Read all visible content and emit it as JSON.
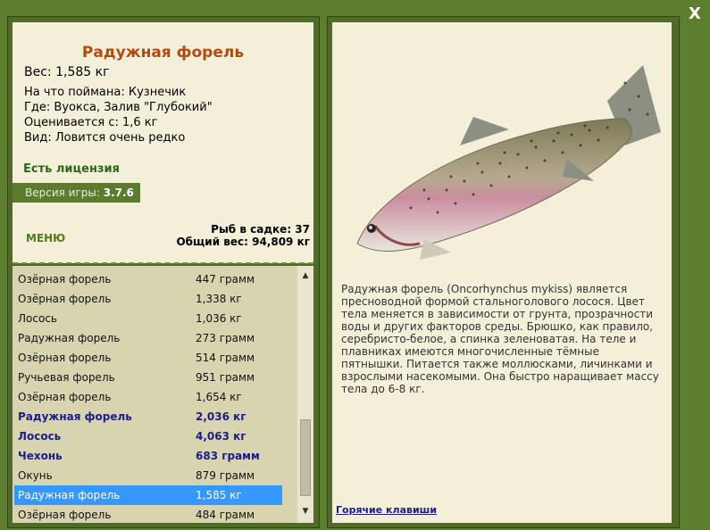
{
  "close_label": "X",
  "fish": {
    "title": "Радужная форель",
    "weight": "Вес: 1,585 кг",
    "caught_with": "На что поймана: Кузнечик",
    "where": "Где: Вуокса, Залив \"Глубокий\"",
    "rated_from": "Оценивается с: 1,6 кг",
    "rarity": "Вид: Ловится очень редко"
  },
  "license": "Есть лицензия",
  "version": {
    "label": "Версия игры:",
    "value": "3.7.6"
  },
  "menu_label": "МЕНЮ",
  "stats": {
    "fish_in_net": "Рыб в садке: 37",
    "total_weight": "Общий вес: 94,809 кг"
  },
  "fish_list": [
    {
      "name": "Озёрная форель",
      "weight": "447 грамм",
      "bold": false,
      "selected": false
    },
    {
      "name": "Озёрная форель",
      "weight": "1,338 кг",
      "bold": false,
      "selected": false
    },
    {
      "name": "Лосось",
      "weight": "1,036 кг",
      "bold": false,
      "selected": false
    },
    {
      "name": "Радужная форель",
      "weight": "273 грамм",
      "bold": false,
      "selected": false
    },
    {
      "name": "Озёрная форель",
      "weight": "514 грамм",
      "bold": false,
      "selected": false
    },
    {
      "name": "Ручьевая форель",
      "weight": "951 грамм",
      "bold": false,
      "selected": false
    },
    {
      "name": "Озёрная форель",
      "weight": "1,654 кг",
      "bold": false,
      "selected": false
    },
    {
      "name": "Радужная форель",
      "weight": "2,036 кг",
      "bold": true,
      "selected": false
    },
    {
      "name": "Лосось",
      "weight": "4,063 кг",
      "bold": true,
      "selected": false
    },
    {
      "name": "Чехонь",
      "weight": "683 грамм",
      "bold": true,
      "selected": false
    },
    {
      "name": "Окунь",
      "weight": "879 грамм",
      "bold": false,
      "selected": false
    },
    {
      "name": "Радужная форель",
      "weight": "1,585 кг",
      "bold": false,
      "selected": true
    },
    {
      "name": "Озёрная форель",
      "weight": "484 грамм",
      "bold": false,
      "selected": false
    }
  ],
  "description": "Радужная форель (Oncorhynchus mykiss) является пресноводной формой стальноголового лосося. Цвет тела меняется в зависимости от грунта, прозрачности воды и других факторов среды. Брюшко, как правило, серебристо-белое, а спинка зеленоватая. На теле и плавниках имеются многочисленные тёмные пятнышки. Питается также моллюсками, личинками и взрослыми насекомыми. Она быстро наращивает массу тела до 6-8 кг.",
  "hotkeys_label": "Горячие клавиши",
  "colors": {
    "background": "#5d7d2f",
    "panel": "#f3efd9",
    "list_bg": "#d8d4b0",
    "title": "#b34a12",
    "license": "#2b6a12",
    "bold_row": "#1c1c8a",
    "selected_row": "#3399ff"
  }
}
